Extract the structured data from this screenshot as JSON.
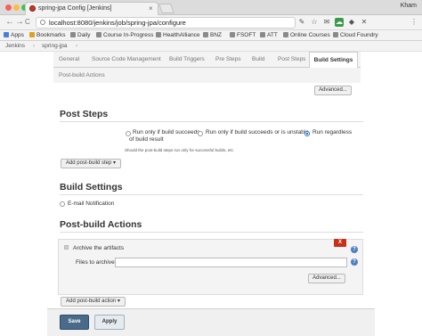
{
  "browser": {
    "tab_title": "spring-jpa Config [Jenkins]",
    "close_glyph": "×",
    "user": "Kham",
    "url": "localhost:8080/jenkins/job/spring-jpa/configure",
    "nav": {
      "back": "←",
      "forward": "→",
      "reload": "C"
    },
    "extensions": [
      "✎",
      "☆",
      "✉",
      "☁",
      "◆",
      "✕",
      "⋮"
    ],
    "window_buttons": {
      "close": "#fc605c",
      "min": "#fdbc40",
      "max": "#34c84a"
    }
  },
  "bookmarks": [
    {
      "label": "Apps",
      "icon": "apps-icon",
      "color": "#4a7ce0"
    },
    {
      "label": "Bookmarks",
      "icon": "star-icon",
      "color": "#e0a020"
    },
    {
      "label": "Daily",
      "icon": "folder-icon",
      "color": "#8a8a8a"
    },
    {
      "label": "Course In-Progress",
      "icon": "folder-icon",
      "color": "#8a8a8a"
    },
    {
      "label": "HealthAlliance",
      "icon": "folder-icon",
      "color": "#8a8a8a"
    },
    {
      "label": "BNZ",
      "icon": "folder-icon",
      "color": "#8a8a8a"
    },
    {
      "label": "FSOFT",
      "icon": "folder-icon",
      "color": "#8a8a8a"
    },
    {
      "label": "ATT",
      "icon": "folder-icon",
      "color": "#8a8a8a"
    },
    {
      "label": "Online Courses",
      "icon": "folder-icon",
      "color": "#8a8a8a"
    },
    {
      "label": "Cloud Foundry",
      "icon": "folder-icon",
      "color": "#8a8a8a"
    }
  ],
  "breadcrumb": {
    "root": "Jenkins",
    "sep": "›",
    "job": "spring-jpa",
    "sep2": "›"
  },
  "config_tabs": {
    "general": "General",
    "scm": "Source Code Management",
    "triggers": "Build Triggers",
    "pre_steps": "Pre Steps",
    "build": "Build",
    "post_steps": "Post Steps",
    "build_settings": "Build Settings",
    "post_build": "Post-build Actions"
  },
  "advanced_label": "Advanced...",
  "post_steps": {
    "heading": "Post Steps",
    "opt1": "Run only if build succeeds",
    "opt2": "Run only if build succeeds or is unstable",
    "opt3_line1": "Run regardless",
    "opt3_line2": "of build result",
    "selected": "Run regardless of build result",
    "note": "Should the post-build steps run only for successful builds, etc.",
    "add_button": "Add post-build step ▾"
  },
  "build_settings": {
    "heading": "Build Settings",
    "email": "E-mail Notification"
  },
  "post_build": {
    "heading": "Post-build Actions",
    "archive_title": "Archive the artifacts",
    "files_label": "Files to archive",
    "files_value": "",
    "delete_glyph": "X",
    "help_glyph": "?",
    "add_button": "Add post-build action ▾"
  },
  "footer": {
    "save": "Save",
    "apply": "Apply"
  }
}
